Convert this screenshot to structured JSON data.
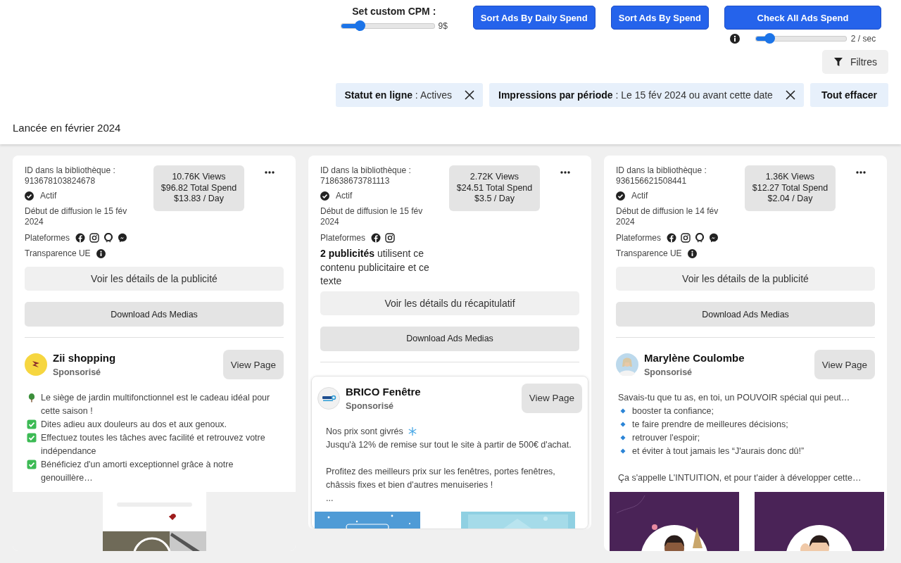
{
  "cpm": {
    "label": "Set custom CPM :",
    "level": 0.2,
    "reading": "9$"
  },
  "sort_buttons": [
    "Sort Ads By Daily Spend",
    "Sort Ads By Spend"
  ],
  "check_button": "Check All Ads Spend",
  "rate": {
    "level": 0.15,
    "reading": "2 / sec"
  },
  "filters_button": "Filtres",
  "chips": [
    "**Statut en ligne** : Actives",
    "**Impressions par période** : Le 15 fév 2024 ou avant cette date"
  ],
  "clear_button": "Tout effacer",
  "section_title": "Lancée en février 2024",
  "cards": [
    {
      "id_label": "ID dans la bibliothèque :",
      "id": "913678103824678",
      "status": "Actif",
      "start": "Début de diffusion le 15 fév 2024",
      "platforms_label": "Plateformes",
      "platforms": [
        {
          "kind": "facebook"
        },
        {
          "kind": "instagram"
        },
        {
          "kind": "audience"
        },
        {
          "kind": "messenger"
        }
      ],
      "transparency": "Transparence UE",
      "stats": [
        "10.76K Views",
        "$96.82 Total Spend",
        "$13.83 / Day"
      ],
      "details_button": "Voir les détails de la publicité",
      "download_button": "Download Ads Medias",
      "ad": {
        "framed": false,
        "name": "Zii shopping",
        "sponsored": "Sponsorisé",
        "view_page": "View Page",
        "body": [
          [
            {
              "kind": "tree",
              "text": "Le siège de jardin multifonctionnel est le cadeau idéal pour cette saison !"
            },
            {
              "kind": "check",
              "text": "Dites adieu aux douleurs au dos et aux genoux."
            },
            {
              "kind": "check",
              "text": "Effectuez toutes les tâches avec facilité et retrouvez votre indépendance"
            },
            {
              "kind": "check",
              "text": "Bénéficiez d'un amorti exceptionnel grâce à notre genouillère…"
            }
          ]
        ]
      }
    },
    {
      "id_label": "ID dans la bibliothèque :",
      "id": "718638673781113",
      "status": "Actif",
      "start": "Début de diffusion le 15 fév 2024",
      "platforms_label": "Plateformes",
      "platforms": [
        {
          "kind": "facebook"
        },
        {
          "kind": "instagram"
        }
      ],
      "summary": "**2 publicités** utilisent ce contenu publicitaire et ce texte",
      "stats": [
        "2.72K Views",
        "$24.51 Total Spend",
        "$3.5 / Day"
      ],
      "details_button": "Voir les détails du récapitulatif",
      "download_button": "Download Ads Medias",
      "ad": {
        "framed": true,
        "name": "BRICO Fenêtre",
        "sponsored": "Sponsorisé",
        "view_page": "View Page",
        "body": [
          [
            {
              "kind": "snowflake",
              "text": "Nos prix sont givrés"
            },
            {
              "kind": "plain",
              "text": "Jusqu'à 12% de remise sur tout le site à partir de 500€ d'achat."
            }
          ],
          [
            {
              "kind": "plain",
              "text": "Profitez des meilleurs prix sur les fenêtres, portes fenêtres, châssis fixes et bien d'autres menuiseries !"
            },
            {
              "kind": "plain",
              "text": "..."
            }
          ]
        ]
      }
    },
    {
      "id_label": "ID dans la bibliothèque :",
      "id": "936156621508441",
      "status": "Actif",
      "start": "Début de diffusion le 14 fév 2024",
      "platforms_label": "Plateformes",
      "platforms": [
        {
          "kind": "facebook"
        },
        {
          "kind": "instagram"
        },
        {
          "kind": "audience"
        },
        {
          "kind": "messenger"
        }
      ],
      "transparency": "Transparence UE",
      "stats": [
        "1.36K Views",
        "$12.27 Total Spend",
        "$2.04 / Day"
      ],
      "details_button": "Voir les détails de la publicité",
      "download_button": "Download Ads Medias",
      "ad": {
        "framed": false,
        "name": "Marylène Coulombe",
        "sponsored": "Sponsorisé",
        "view_page": "View Page",
        "body": [
          [
            {
              "kind": "plain",
              "text": "Savais-tu que tu as, en toi, un POUVOIR spécial qui peut…"
            },
            {
              "kind": "diamond",
              "text": "booster ta confiance;"
            },
            {
              "kind": "diamond",
              "text": "te faire prendre de meilleures décisions;"
            },
            {
              "kind": "diamond",
              "text": "retrouver l'espoir;"
            },
            {
              "kind": "diamond",
              "text": "et éviter à tout jamais les “J'aurais donc dû!”"
            }
          ],
          [
            {
              "kind": "plain",
              "text": "Ça s'appelle L'INTUITION, et pour t'aider à développer cette…"
            }
          ]
        ]
      }
    }
  ]
}
